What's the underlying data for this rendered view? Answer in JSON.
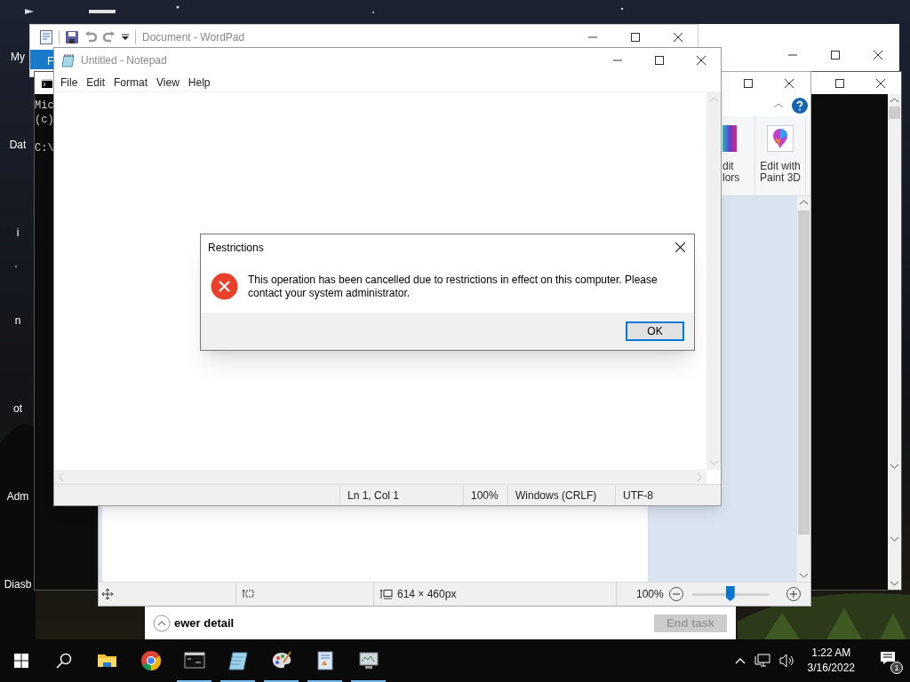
{
  "desktop_icons": [
    {
      "label": "My"
    },
    {
      "label": "Dat"
    },
    {
      "label": "i"
    },
    {
      "label": "n"
    },
    {
      "label": "ot"
    },
    {
      "label": "Adm"
    },
    {
      "label": "Diasb"
    }
  ],
  "task_manager": {
    "details_toggle": "ewer detail",
    "end_task": {
      "label": "End task",
      "disabled": true
    }
  },
  "wordpad": {
    "title": "Document - WordPad",
    "file_tab": "F"
  },
  "console": {
    "lines": [
      "Mic",
      "(c)"
    ],
    "prompt": "C:\\"
  },
  "paint": {
    "ribbon_buttons": [
      {
        "kind": "colors",
        "lines": [
          "dit",
          "lors"
        ]
      },
      {
        "kind": "paint3d",
        "lines": [
          "Edit with",
          "Paint 3D"
        ]
      }
    ],
    "image_size": "614 × 460px",
    "zoom": "100%",
    "zoom_slider": {
      "level": 0.5
    }
  },
  "notepad": {
    "title": "Untitled - Notepad",
    "menu": [
      "File",
      "Edit",
      "Format",
      "View",
      "Help"
    ],
    "status_bar": [
      "Ln 1, Col 1",
      "100%",
      "Windows (CRLF)",
      "UTF-8"
    ]
  },
  "dialog": {
    "title": "Restrictions",
    "message": "This operation has been cancelled due to restrictions in effect on this computer. Please contact your system administrator.",
    "buttons": [
      {
        "label": "OK",
        "focused": true
      }
    ]
  },
  "taskbar": {
    "apps": [
      {
        "kind": "explorer",
        "running": false
      },
      {
        "kind": "chrome",
        "running": false
      },
      {
        "kind": "console",
        "running": true
      },
      {
        "kind": "notepad",
        "running": true
      },
      {
        "kind": "paint",
        "running": true
      },
      {
        "kind": "wordpad",
        "running": true
      },
      {
        "kind": "monitor",
        "running": true
      }
    ],
    "clock": {
      "time": "1:22 AM",
      "date": "3/16/2022"
    },
    "notifications": "1"
  }
}
